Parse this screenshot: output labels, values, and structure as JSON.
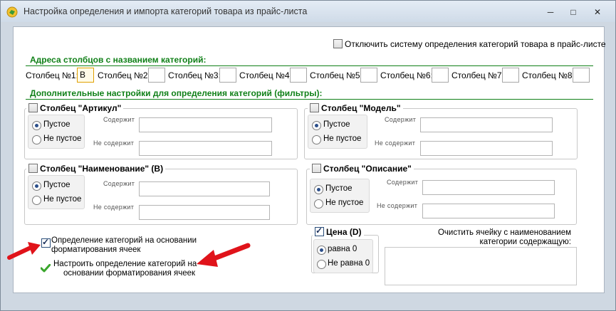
{
  "window": {
    "title": "Настройка определения и импорта категорий товара из прайс-листа",
    "minimize": "─",
    "maximize": "□",
    "close": "✕"
  },
  "disable_system": {
    "label": "Отключить систему определения категорий товара в прайс-листе",
    "checked": false
  },
  "addresses": {
    "heading": "Адреса столбцов с названием категорий:",
    "columns": [
      {
        "label": "Столбец №1:",
        "value": "B"
      },
      {
        "label": "Столбец №2:",
        "value": ""
      },
      {
        "label": "Столбец №3:",
        "value": ""
      },
      {
        "label": "Столбец №4:",
        "value": ""
      },
      {
        "label": "Столбец №5:",
        "value": ""
      },
      {
        "label": "Столбец №6:",
        "value": ""
      },
      {
        "label": "Столбец №7:",
        "value": ""
      },
      {
        "label": "Столбец №8:",
        "value": ""
      }
    ]
  },
  "filters": {
    "heading": "Дополнительные настройки для определения категорий (фильтры):",
    "contains_label": "Содержит",
    "not_contains_label": "Не содержит",
    "empty_label": "Пустое",
    "not_empty_label": "Не пустое",
    "groups": {
      "article": {
        "title": "Столбец \"Артикул\"",
        "checked": false
      },
      "model": {
        "title": "Столбец \"Модель\"",
        "checked": false
      },
      "name": {
        "title": "Столбец \"Наименование\" (B)",
        "checked": false
      },
      "description": {
        "title": "Столбец \"Описание\"",
        "checked": false
      }
    }
  },
  "price": {
    "title": "Цена (D)",
    "checked": true,
    "equal_zero": "равна 0",
    "not_equal_zero": "Не равна 0"
  },
  "formatting": {
    "checkbox_line1": "Определение категорий на основании",
    "checkbox_line2": "форматирования ячеек",
    "checked": true,
    "link_line1": "Настроить определение категорий на",
    "link_line2": "основании форматирования ячеек",
    "arrow_color": "#e0131a",
    "check_color": "#3aa62c"
  },
  "clear_cell": {
    "line1": "Очистить ячейку с наименованием",
    "line2": "категории содержащую:"
  }
}
